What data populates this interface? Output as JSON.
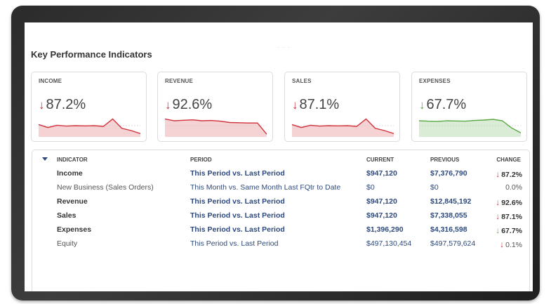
{
  "section_title": "Key Performance Indicators",
  "cards": [
    {
      "label": "INCOME",
      "value": "87.2%",
      "direction": "down",
      "color": "#d0313b",
      "sparkline": [
        0.55,
        0.42,
        0.52,
        0.48,
        0.5,
        0.49,
        0.5,
        0.47,
        0.8,
        0.38,
        0.28,
        0.15
      ]
    },
    {
      "label": "REVENUE",
      "value": "92.6%",
      "direction": "down",
      "color": "#d0313b",
      "sparkline": [
        0.8,
        0.72,
        0.74,
        0.76,
        0.72,
        0.73,
        0.7,
        0.64,
        0.63,
        0.62,
        0.62,
        0.12
      ]
    },
    {
      "label": "SALES",
      "value": "87.1%",
      "direction": "down",
      "color": "#d0313b",
      "sparkline": [
        0.55,
        0.42,
        0.52,
        0.48,
        0.5,
        0.49,
        0.5,
        0.47,
        0.8,
        0.38,
        0.28,
        0.15
      ]
    },
    {
      "label": "EXPENSES",
      "value": "67.7%",
      "direction": "up",
      "color": "#5aa845",
      "sparkline": [
        0.72,
        0.7,
        0.69,
        0.72,
        0.71,
        0.7,
        0.73,
        0.75,
        0.78,
        0.72,
        0.4,
        0.18
      ]
    }
  ],
  "table": {
    "headers": {
      "indicator": "INDICATOR",
      "period": "PERIOD",
      "current": "CURRENT",
      "previous": "PREVIOUS",
      "change": "CHANGE"
    },
    "rows": [
      {
        "indicator": "Income",
        "period_a": "This Period",
        "period_sep": " vs. ",
        "period_b": "Last Period",
        "current": "$947,120",
        "previous": "$7,376,790",
        "change": "87.2%",
        "direction": "down",
        "bold": true
      },
      {
        "indicator": "New Business (Sales Orders)",
        "period_a": "This Month",
        "period_sep": " vs. ",
        "period_b": "Same Month Last FQtr to Date",
        "current": "$0",
        "previous": "$0",
        "change": "0.0%",
        "direction": "none",
        "bold": false
      },
      {
        "indicator": "Revenue",
        "period_a": "This Period",
        "period_sep": " vs. ",
        "period_b": "Last Period",
        "current": "$947,120",
        "previous": "$12,845,192",
        "change": "92.6%",
        "direction": "down",
        "bold": true
      },
      {
        "indicator": "Sales",
        "period_a": "This Period",
        "period_sep": " vs. ",
        "period_b": "Last Period",
        "current": "$947,120",
        "previous": "$7,338,055",
        "change": "87.1%",
        "direction": "down",
        "bold": true
      },
      {
        "indicator": "Expenses",
        "period_a": "This Period",
        "period_sep": " vs. ",
        "period_b": "Last Period",
        "current": "$1,396,290",
        "previous": "$4,316,598",
        "change": "67.7%",
        "direction": "up",
        "bold": true
      },
      {
        "indicator": "Equity",
        "period_a": "This Period",
        "period_sep": " vs. ",
        "period_b": "Last Period",
        "current": "$497,130,454",
        "previous": "$497,579,624",
        "change": "0.1%",
        "direction": "down",
        "bold": false
      }
    ]
  }
}
